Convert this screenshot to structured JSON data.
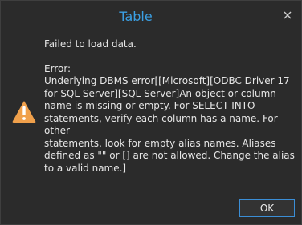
{
  "dialog": {
    "title": "Table",
    "close_icon": "close-icon",
    "warning_icon": "warning-triangle-icon",
    "message_intro": "Failed to load data.",
    "error_heading": "Error:",
    "error_lines": [
      "Underlying DBMS error[[Microsoft][ODBC Driver 17",
      "for SQL Server][SQL Server]An object or column",
      "name is missing or empty. For SELECT INTO",
      "statements, verify each column has a name. For other",
      "statements, look for empty alias names. Aliases",
      "defined as \"\" or [] are not allowed. Change the alias",
      "to a valid name.]"
    ],
    "ok_label": "OK",
    "colors": {
      "background": "#2b2b2b",
      "title": "#3b9fe3",
      "text": "#e6e6e6",
      "warning": "#f0a04b",
      "button_border": "#3b8ed6"
    }
  }
}
